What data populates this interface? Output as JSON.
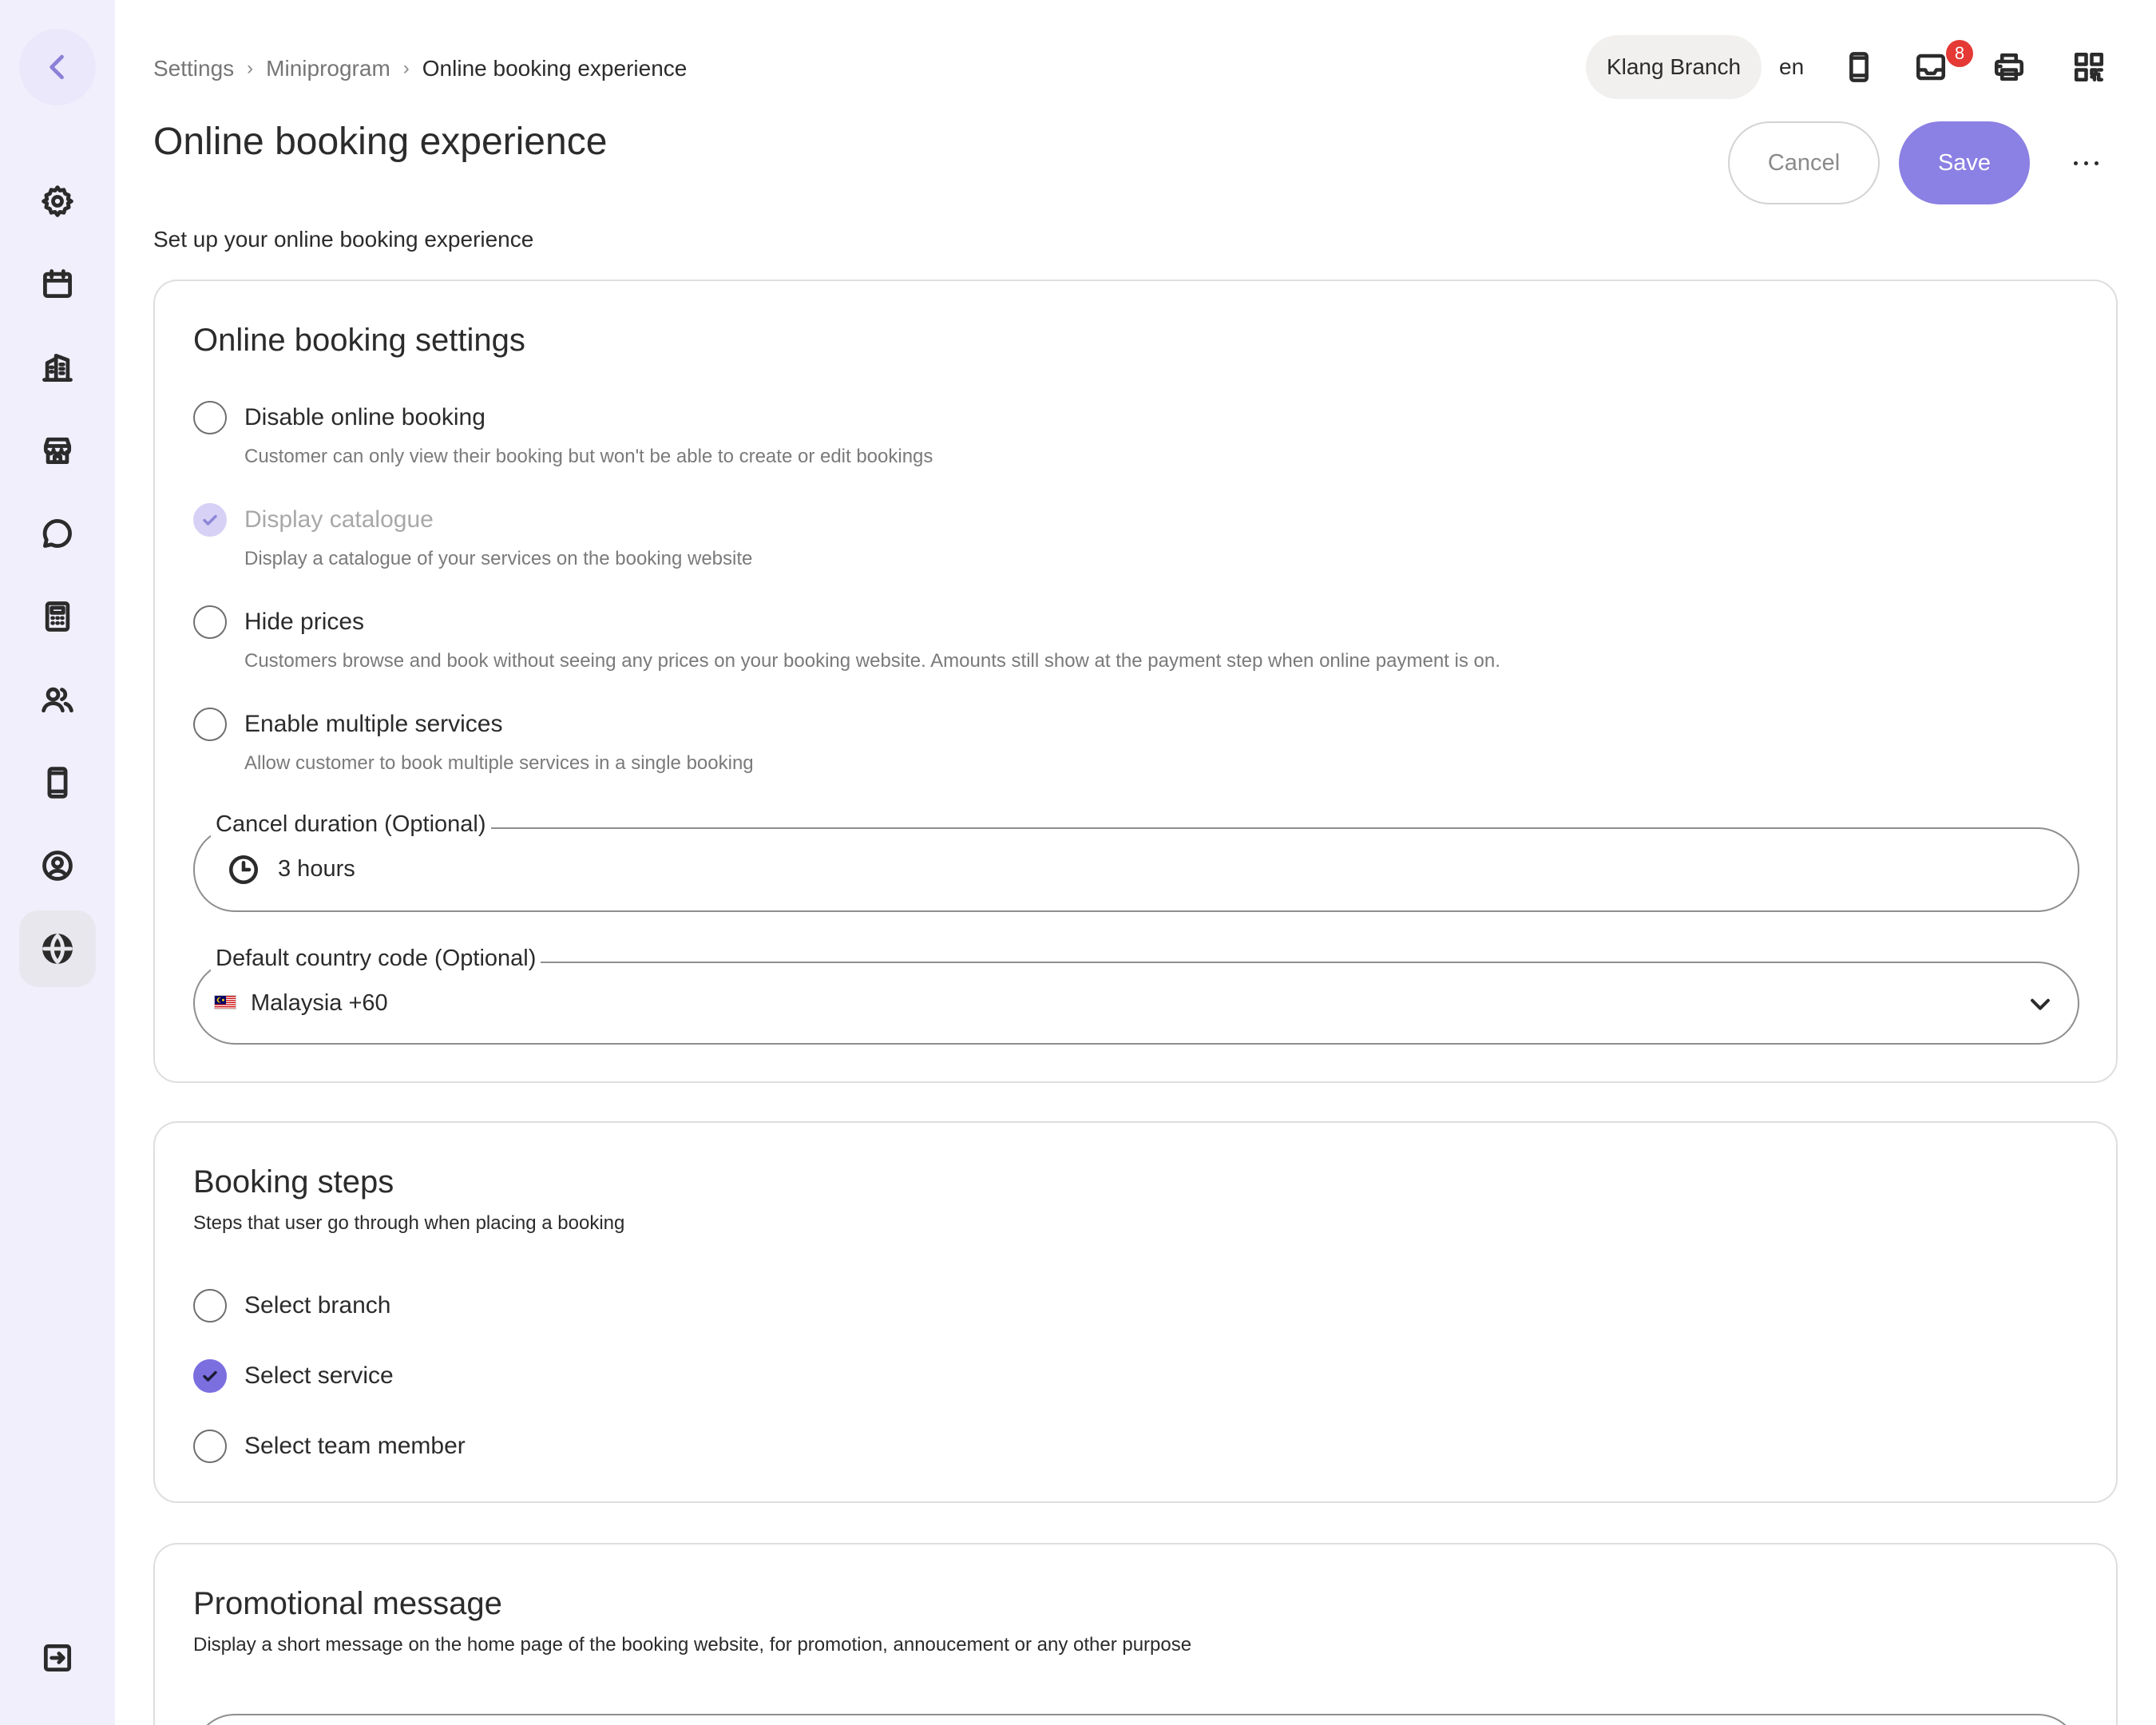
{
  "breadcrumb": {
    "items": [
      "Settings",
      "Miniprogram"
    ],
    "current": "Online booking experience"
  },
  "header": {
    "branch": "Klang Branch",
    "language": "en",
    "inbox_badge": "8",
    "icons": [
      "phone-icon",
      "inbox-icon",
      "printer-icon",
      "qr-code-icon"
    ]
  },
  "page": {
    "title": "Online booking experience",
    "subtitle": "Set up your online booking experience",
    "cancel_label": "Cancel",
    "save_label": "Save"
  },
  "sidebar": {
    "icons": [
      "back-icon",
      "settings-icon",
      "calendar-icon",
      "building-icon",
      "store-icon",
      "chat-icon",
      "calculator-icon",
      "users-icon",
      "mobile-icon",
      "user-circle-icon",
      "globe-icon",
      "logout-icon"
    ],
    "active": "globe-icon"
  },
  "online_booking_settings": {
    "title": "Online booking settings",
    "options": [
      {
        "label": "Disable online booking",
        "help": "Customer can only view their booking but won't be able to create or edit bookings",
        "checked": false,
        "disabled": false
      },
      {
        "label": "Display catalogue",
        "help": "Display a catalogue of your services on the booking website",
        "checked": true,
        "disabled": true
      },
      {
        "label": "Hide prices",
        "help": "Customers browse and book without seeing any prices on your booking website. Amounts still show at the payment step when online payment is on.",
        "checked": false,
        "disabled": false
      },
      {
        "label": "Enable multiple services",
        "help": "Allow customer to book multiple services in a single booking",
        "checked": false,
        "disabled": false
      }
    ],
    "cancel_duration": {
      "label": "Cancel duration (Optional)",
      "value": "3 hours"
    },
    "country_code": {
      "label": "Default country code (Optional)",
      "value": "Malaysia +60"
    }
  },
  "booking_steps": {
    "title": "Booking steps",
    "description": "Steps that user go through when placing a booking",
    "steps": [
      {
        "label": "Select branch",
        "checked": false
      },
      {
        "label": "Select service",
        "checked": true
      },
      {
        "label": "Select team member",
        "checked": false
      }
    ]
  },
  "promotional_message": {
    "title": "Promotional message",
    "description": "Display a short message on the home page of the booking website, for promotion, annoucement or any other purpose"
  },
  "colors": {
    "accent": "#8b80e3",
    "sidebar_bg": "#f1effc",
    "badge": "#e53935"
  }
}
